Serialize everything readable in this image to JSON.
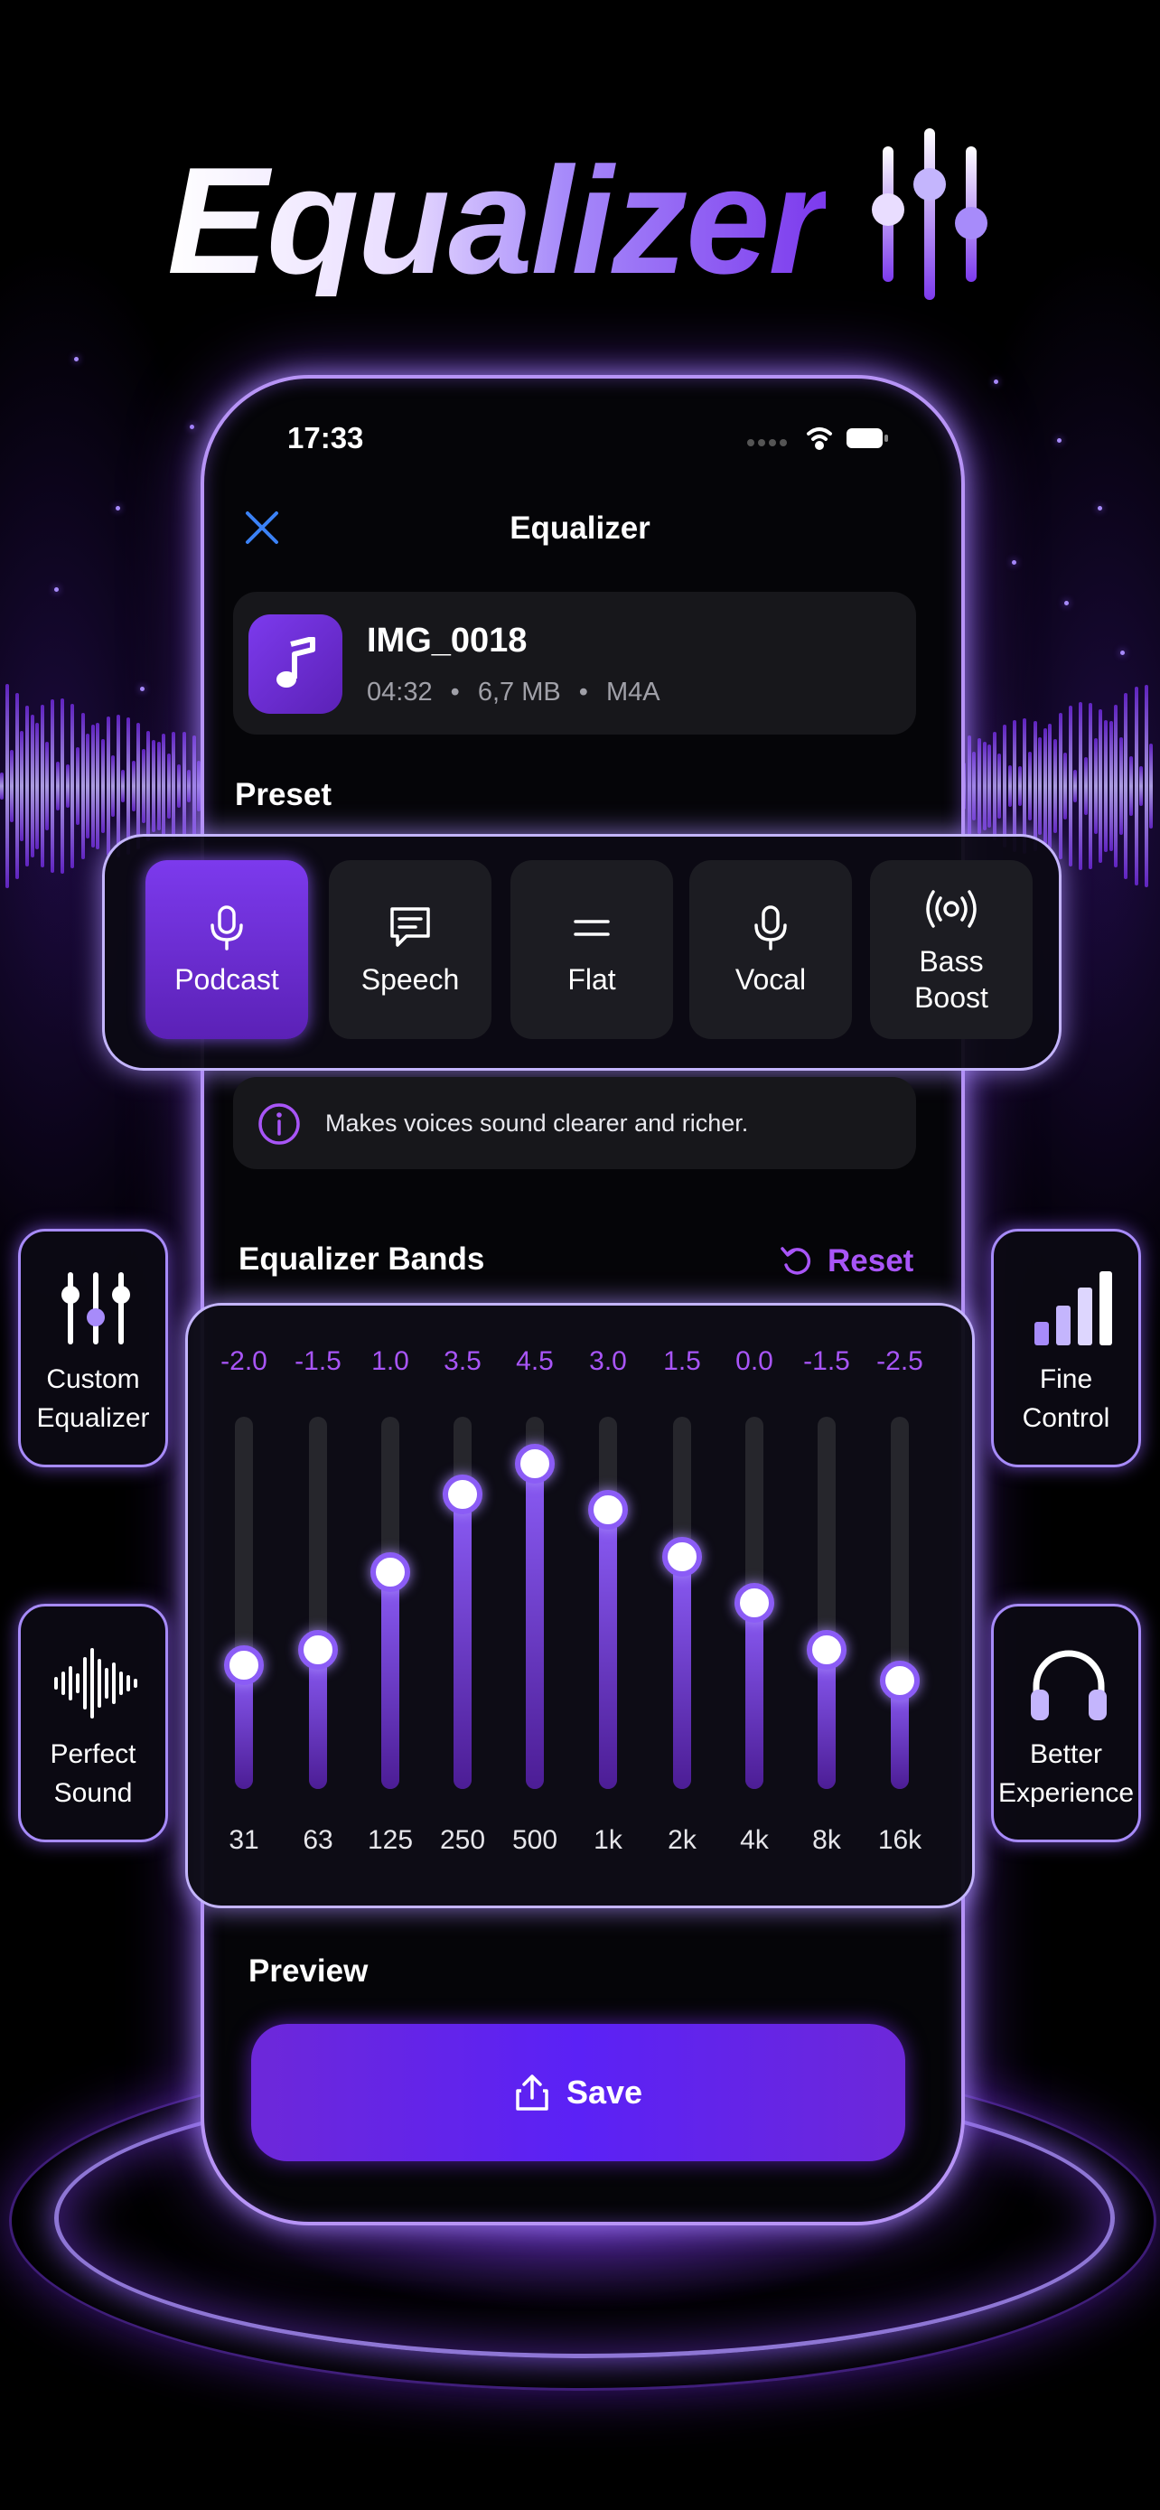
{
  "headline": "Equalizer",
  "status": {
    "time": "17:33"
  },
  "nav": {
    "title": "Equalizer"
  },
  "file": {
    "name": "IMG_0018",
    "duration": "04:32",
    "size": "6,7 MB",
    "format": "M4A",
    "separator": "•"
  },
  "preset": {
    "section_label": "Preset",
    "items": [
      {
        "label": "Podcast",
        "icon": "microphone-icon",
        "active": true
      },
      {
        "label": "Speech",
        "icon": "speech-bubble-icon",
        "active": false
      },
      {
        "label": "Flat",
        "icon": "flat-lines-icon",
        "active": false
      },
      {
        "label": "Vocal",
        "icon": "microphone-icon",
        "active": false
      },
      {
        "label": "Bass Boost",
        "icon": "broadcast-icon",
        "active": false
      }
    ],
    "description": "Makes voices sound clearer and richer."
  },
  "bands": {
    "section_label": "Equalizer Bands",
    "reset_label": "Reset",
    "items": [
      {
        "freq": "31",
        "value": "-2.0"
      },
      {
        "freq": "63",
        "value": "-1.5"
      },
      {
        "freq": "125",
        "value": "1.0"
      },
      {
        "freq": "250",
        "value": "3.5"
      },
      {
        "freq": "500",
        "value": "4.5"
      },
      {
        "freq": "1k",
        "value": "3.0"
      },
      {
        "freq": "2k",
        "value": "1.5"
      },
      {
        "freq": "4k",
        "value": "0.0"
      },
      {
        "freq": "8k",
        "value": "-1.5"
      },
      {
        "freq": "16k",
        "value": "-2.5"
      }
    ]
  },
  "preview": {
    "label": "Preview",
    "save_label": "Save"
  },
  "badges": {
    "custom_equalizer": "Custom Equalizer",
    "fine_control": "Fine Control",
    "perfect_sound": "Perfect Sound",
    "better_experience": "Better Experience"
  },
  "colors": {
    "accent": "#7c3aed",
    "accent_text": "#a855f7",
    "close": "#3b82f6",
    "background": "#000000"
  }
}
